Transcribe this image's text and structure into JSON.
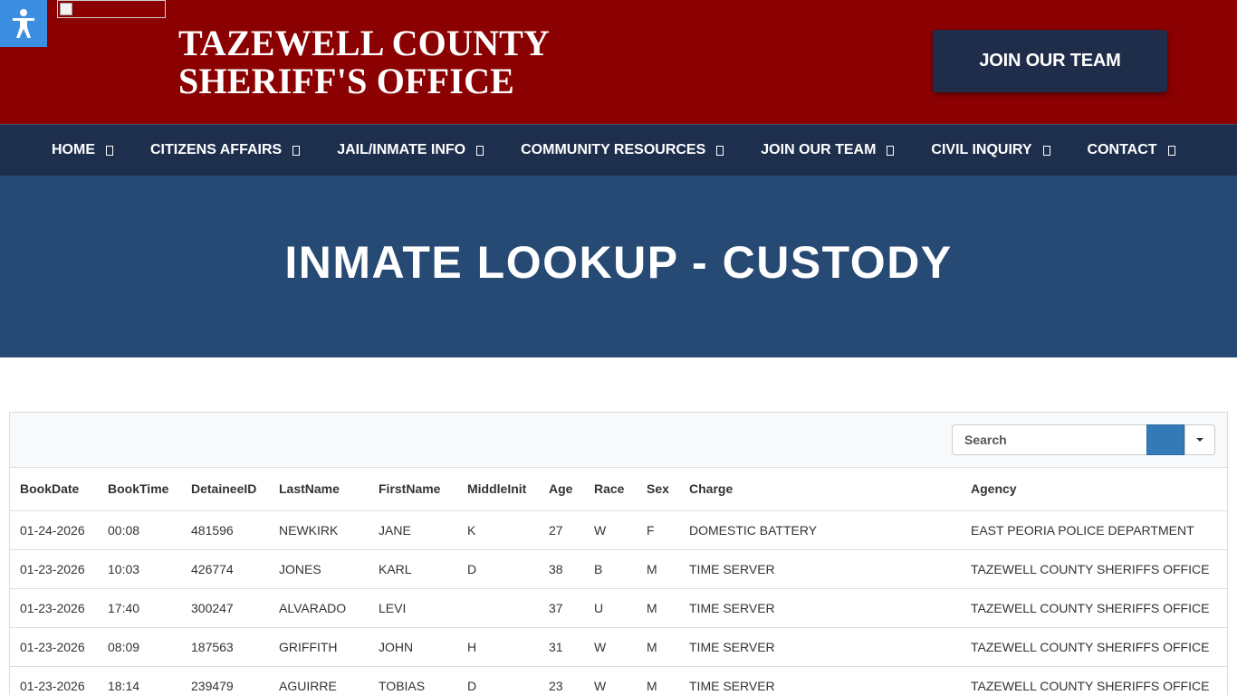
{
  "header": {
    "brand_line1": "TAZEWELL COUNTY",
    "brand_line2": "SHERIFF'S OFFICE",
    "join_button": "JOIN OUR TEAM",
    "accent_color": "#8b0000"
  },
  "nav": {
    "items": [
      {
        "label": "HOME"
      },
      {
        "label": "CITIZENS AFFAIRS"
      },
      {
        "label": "JAIL/INMATE INFO"
      },
      {
        "label": "COMMUNITY RESOURCES"
      },
      {
        "label": "JOIN OUR TEAM"
      },
      {
        "label": "CIVIL INQUIRY"
      },
      {
        "label": "CONTACT"
      }
    ]
  },
  "hero": {
    "title": "INMATE LOOKUP - CUSTODY"
  },
  "table": {
    "search_placeholder": "Search",
    "columns": [
      "BookDate",
      "BookTime",
      "DetaineeID",
      "LastName",
      "FirstName",
      "MiddleInit",
      "Age",
      "Race",
      "Sex",
      "Charge",
      "Agency"
    ],
    "rows": [
      [
        "01-24-2026",
        "00:08",
        "481596",
        "NEWKIRK",
        "JANE",
        "K",
        "27",
        "W",
        "F",
        "DOMESTIC BATTERY",
        "EAST PEORIA POLICE DEPARTMENT"
      ],
      [
        "01-23-2026",
        "10:03",
        "426774",
        "JONES",
        "KARL",
        "D",
        "38",
        "B",
        "M",
        "TIME SERVER",
        "TAZEWELL COUNTY SHERIFFS OFFICE"
      ],
      [
        "01-23-2026",
        "17:40",
        "300247",
        "ALVARADO",
        "LEVI",
        "",
        "37",
        "U",
        "M",
        "TIME SERVER",
        "TAZEWELL COUNTY SHERIFFS OFFICE"
      ],
      [
        "01-23-2026",
        "08:09",
        "187563",
        "GRIFFITH",
        "JOHN",
        "H",
        "31",
        "W",
        "M",
        "TIME SERVER",
        "TAZEWELL COUNTY SHERIFFS OFFICE"
      ],
      [
        "01-23-2026",
        "18:14",
        "239479",
        "AGUIRRE",
        "TOBIAS",
        "D",
        "23",
        "W",
        "M",
        "TIME SERVER",
        "TAZEWELL COUNTY SHERIFFS OFFICE"
      ]
    ]
  }
}
